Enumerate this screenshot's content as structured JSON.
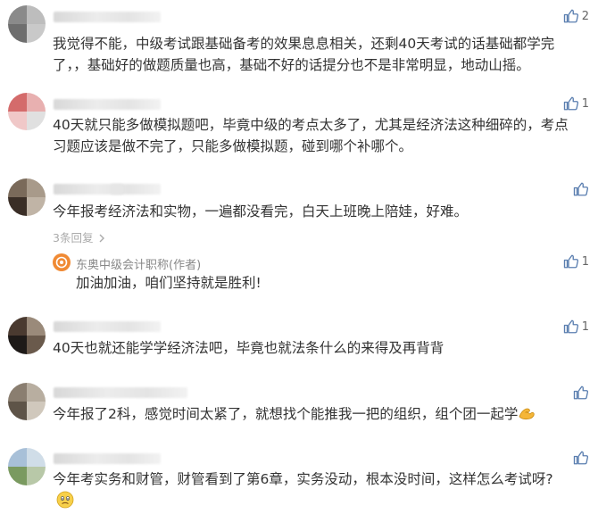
{
  "comments": [
    {
      "text": "我觉得不能，中级考试跟基础备考的效果息息相关，还剩40天考试的话基础都学完了，，基础好的做题质量也高，基础不好的话提分也不是非常明显，地动山摇。",
      "likes": "2"
    },
    {
      "text": "40天就只能多做模拟题吧，毕竟中级的考点太多了，尤其是经济法这种细碎的，考点习题应该是做不完了，只能多做模拟题，碰到哪个补哪个。",
      "likes": "1"
    },
    {
      "text": "今年报考经济法和实物，一遍都没看完，白天上班晚上陪娃，好难。",
      "likes": "",
      "replies_link": "3条回复",
      "author_reply": {
        "author": "东奥中级会计职称(作者)",
        "text": "加油加油，咱们坚持就是胜利!",
        "likes": "1"
      }
    },
    {
      "text": "40天也就还能学学经济法吧，毕竟也就法条什么的来得及再背背",
      "likes": "1"
    },
    {
      "text": "今年报了2科，感觉时间太紧了，就想找个能推我一把的组织，组个团一起学",
      "likes": "",
      "emoji": "flexed-biceps-emoji"
    },
    {
      "text": "今年考实务和财管，财管看到了第6章，实务没动，根本没时间，这样怎么考试呀?",
      "likes": "",
      "emoji": "worried-face-emoji"
    }
  ],
  "icons": {
    "like": "thumbs-up-icon",
    "reply_chevron": "chevron-right-icon",
    "author_logo": "dongao-logo"
  },
  "colors": {
    "text": "#333333",
    "muted": "#aaaaaa",
    "like_icon": "#5b7fb0",
    "author_logo": "#f08a34"
  }
}
